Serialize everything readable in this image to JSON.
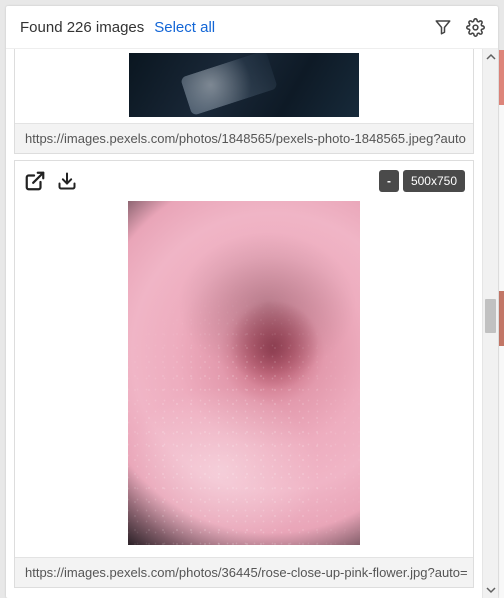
{
  "header": {
    "found_label": "Found 226 images",
    "select_all": "Select all"
  },
  "cards": [
    {
      "url": "https://images.pexels.com/photos/1848565/pexels-photo-1848565.jpeg?auto"
    },
    {
      "zoom_label": "-",
      "dimensions": "500x750",
      "url": "https://images.pexels.com/photos/36445/rose-close-up-pink-flower.jpg?auto="
    }
  ]
}
